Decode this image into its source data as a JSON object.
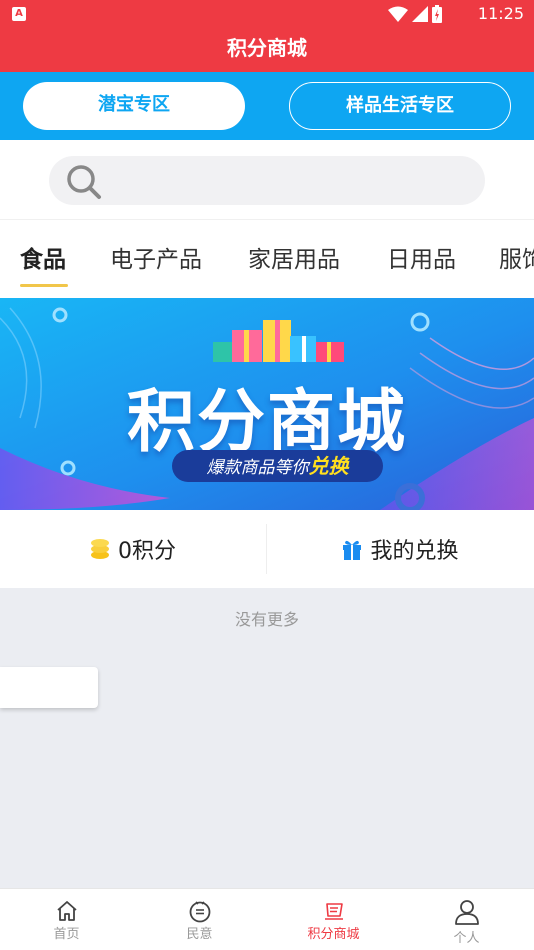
{
  "status_bar": {
    "notification_icon": "A",
    "time": "11:25"
  },
  "title": "积分商城",
  "zones": {
    "active": "潜宝专区",
    "inactive": "样品生活专区"
  },
  "search": {
    "placeholder": "",
    "icon": "search-icon"
  },
  "tabs": [
    {
      "label": "食品",
      "active": true
    },
    {
      "label": "电子产品",
      "active": false
    },
    {
      "label": "家居用品",
      "active": false
    },
    {
      "label": "日用品",
      "active": false
    },
    {
      "label": "服饰",
      "active": false
    }
  ],
  "banner": {
    "title": "积分商城",
    "subtitle_prefix": "爆款商品等你",
    "subtitle_highlight": "兑换"
  },
  "points": {
    "value": "0积分",
    "exchange_label": "我的兑换"
  },
  "list_footer": "没有更多",
  "bottom_nav": [
    {
      "label": "首页",
      "icon": "home-icon",
      "active": false
    },
    {
      "label": "民意",
      "icon": "opinion-icon",
      "active": false
    },
    {
      "label": "积分商城",
      "icon": "mall-icon",
      "active": true
    },
    {
      "label": "个人",
      "icon": "person-icon",
      "active": false
    }
  ],
  "colors": {
    "brand_red": "#ee3a43",
    "zone_blue": "#0ea6f2",
    "tab_underline": "#f1c64a",
    "coin_yellow": "#f7c21a",
    "gift_blue": "#1a8cf0"
  }
}
